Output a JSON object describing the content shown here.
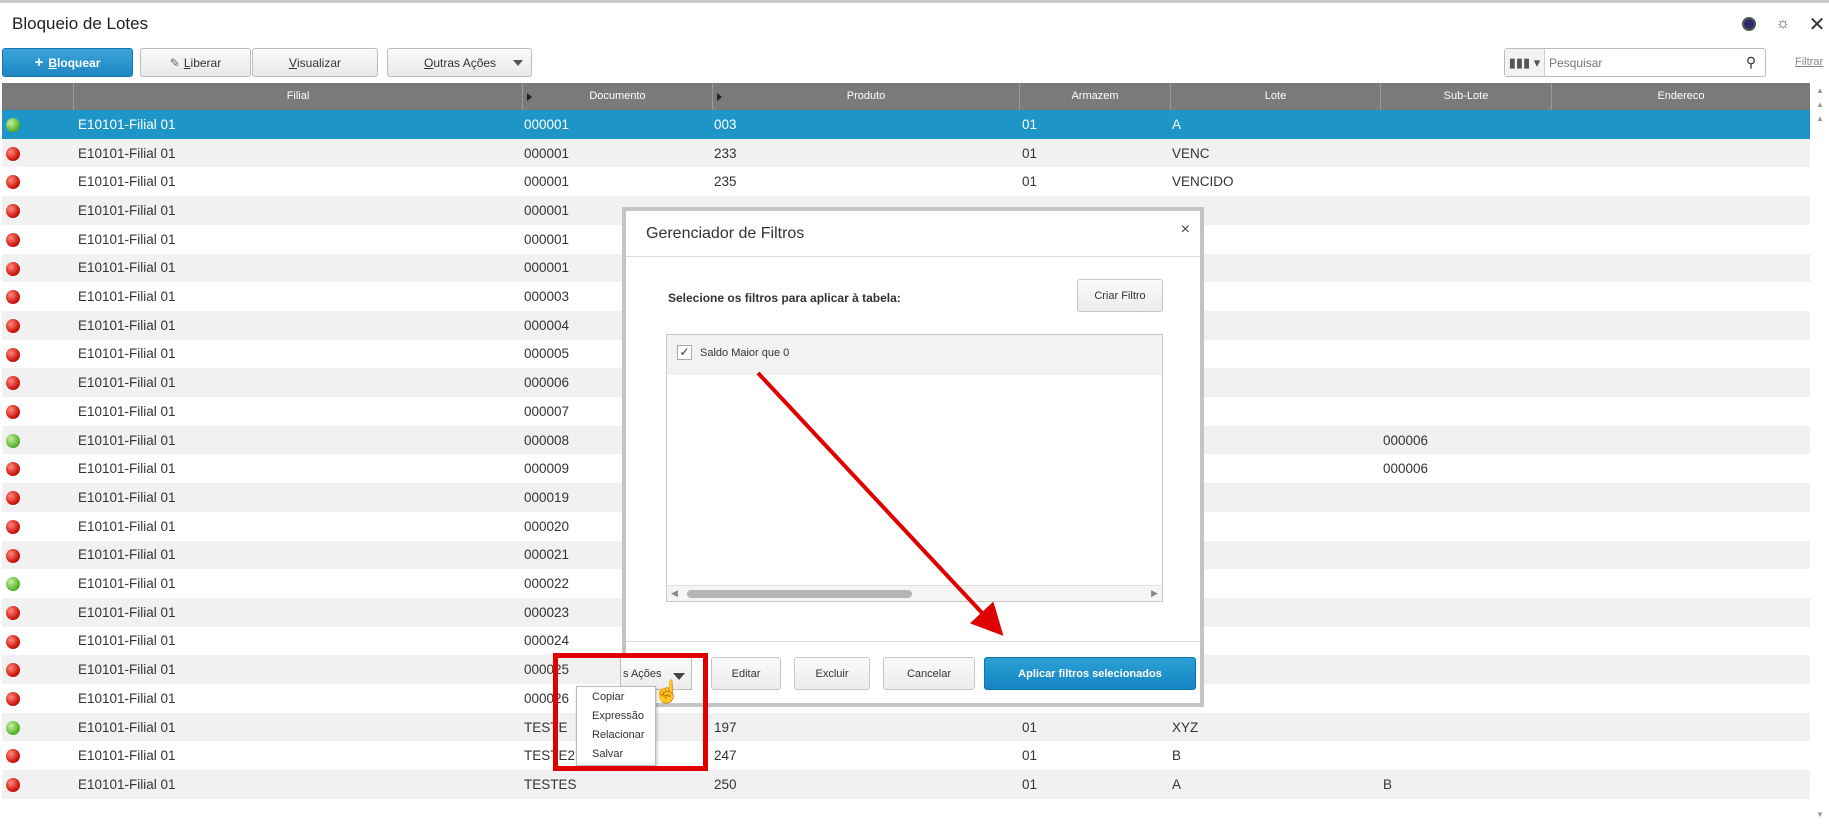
{
  "page": {
    "title": "Bloqueio de Lotes"
  },
  "toolbar": {
    "bloquear_plus": "+",
    "bloquear_first": "B",
    "bloquear_rest": "loquear",
    "liberar_first": "L",
    "liberar_rest": "iberar",
    "visualizar_first": "V",
    "visualizar_rest": "isualizar",
    "outras_first": "O",
    "outras_rest": "utras Ações",
    "search_placeholder": "Pesquisar",
    "filtrar": "Filtrar"
  },
  "grid": {
    "columns": [
      "Filial",
      "Documento",
      "Produto",
      "Armazem",
      "Lote",
      "Sub-Lote",
      "Endereco"
    ],
    "rows": [
      {
        "status": "green",
        "filial": "E10101-Filial 01",
        "documento": "000001",
        "produto": "003",
        "armazem": "01",
        "lote": "A",
        "sublote": "",
        "endereco": ""
      },
      {
        "status": "red",
        "filial": "E10101-Filial 01",
        "documento": "000001",
        "produto": "233",
        "armazem": "01",
        "lote": "VENC",
        "sublote": "",
        "endereco": ""
      },
      {
        "status": "red",
        "filial": "E10101-Filial 01",
        "documento": "000001",
        "produto": "235",
        "armazem": "01",
        "lote": "VENCIDO",
        "sublote": "",
        "endereco": ""
      },
      {
        "status": "red",
        "filial": "E10101-Filial 01",
        "documento": "000001",
        "produto": "",
        "armazem": "",
        "lote": "",
        "sublote": "",
        "endereco": ""
      },
      {
        "status": "red",
        "filial": "E10101-Filial 01",
        "documento": "000001",
        "produto": "",
        "armazem": "",
        "lote": "",
        "sublote": "",
        "endereco": ""
      },
      {
        "status": "red",
        "filial": "E10101-Filial 01",
        "documento": "000001",
        "produto": "",
        "armazem": "",
        "lote": "",
        "sublote": "",
        "endereco": ""
      },
      {
        "status": "red",
        "filial": "E10101-Filial 01",
        "documento": "000003",
        "produto": "",
        "armazem": "",
        "lote": "",
        "sublote": "",
        "endereco": ""
      },
      {
        "status": "red",
        "filial": "E10101-Filial 01",
        "documento": "000004",
        "produto": "",
        "armazem": "",
        "lote": "",
        "sublote": "",
        "endereco": ""
      },
      {
        "status": "red",
        "filial": "E10101-Filial 01",
        "documento": "000005",
        "produto": "",
        "armazem": "",
        "lote": "",
        "sublote": "",
        "endereco": ""
      },
      {
        "status": "red",
        "filial": "E10101-Filial 01",
        "documento": "000006",
        "produto": "",
        "armazem": "",
        "lote": "",
        "sublote": "",
        "endereco": ""
      },
      {
        "status": "red",
        "filial": "E10101-Filial 01",
        "documento": "000007",
        "produto": "",
        "armazem": "",
        "lote": "",
        "sublote": "",
        "endereco": ""
      },
      {
        "status": "green",
        "filial": "E10101-Filial 01",
        "documento": "000008",
        "produto": "",
        "armazem": "",
        "lote": "",
        "sublote": "000006",
        "endereco": ""
      },
      {
        "status": "red",
        "filial": "E10101-Filial 01",
        "documento": "000009",
        "produto": "",
        "armazem": "",
        "lote": "",
        "sublote": "000006",
        "endereco": ""
      },
      {
        "status": "red",
        "filial": "E10101-Filial 01",
        "documento": "000019",
        "produto": "",
        "armazem": "",
        "lote": "",
        "sublote": "",
        "endereco": ""
      },
      {
        "status": "red",
        "filial": "E10101-Filial 01",
        "documento": "000020",
        "produto": "",
        "armazem": "",
        "lote": "",
        "sublote": "",
        "endereco": ""
      },
      {
        "status": "red",
        "filial": "E10101-Filial 01",
        "documento": "000021",
        "produto": "",
        "armazem": "",
        "lote": "",
        "sublote": "",
        "endereco": ""
      },
      {
        "status": "green",
        "filial": "E10101-Filial 01",
        "documento": "000022",
        "produto": "",
        "armazem": "",
        "lote": "",
        "sublote": "",
        "endereco": ""
      },
      {
        "status": "red",
        "filial": "E10101-Filial 01",
        "documento": "000023",
        "produto": "",
        "armazem": "",
        "lote": "",
        "sublote": "",
        "endereco": ""
      },
      {
        "status": "red",
        "filial": "E10101-Filial 01",
        "documento": "000024",
        "produto": "",
        "armazem": "",
        "lote": "",
        "sublote": "",
        "endereco": ""
      },
      {
        "status": "red",
        "filial": "E10101-Filial 01",
        "documento": "000025",
        "produto": "",
        "armazem": "",
        "lote": "",
        "sublote": "",
        "endereco": ""
      },
      {
        "status": "red",
        "filial": "E10101-Filial 01",
        "documento": "000026",
        "produto": "",
        "armazem": "",
        "lote": "",
        "sublote": "",
        "endereco": ""
      },
      {
        "status": "green",
        "filial": "E10101-Filial 01",
        "documento": "TESTE",
        "produto": "197",
        "armazem": "01",
        "lote": "XYZ",
        "sublote": "",
        "endereco": ""
      },
      {
        "status": "red",
        "filial": "E10101-Filial 01",
        "documento": "TESTE2",
        "produto": "247",
        "armazem": "01",
        "lote": "B",
        "sublote": "",
        "endereco": ""
      },
      {
        "status": "red",
        "filial": "E10101-Filial 01",
        "documento": "TESTES",
        "produto": "250",
        "armazem": "01",
        "lote": "A",
        "sublote": "B",
        "endereco": ""
      }
    ]
  },
  "dialog": {
    "title": "Gerenciador de Filtros",
    "close": "×",
    "instruction": "Selecione os filtros para aplicar à tabela:",
    "criar_filtro": "Criar Filtro",
    "filters": [
      {
        "label": "Saldo Maior que 0",
        "checked": true,
        "check_glyph": "✓"
      }
    ],
    "outras_label": "s Ações",
    "editar": "Editar",
    "excluir": "Excluir",
    "cancelar": "Cancelar",
    "aplicar": "Aplicar filtros selecionados"
  },
  "menu": {
    "items": [
      "Copiar",
      "Expressão",
      "Relacionar",
      "Salvar"
    ]
  },
  "colors": {
    "accent": "#1e95c7",
    "annotation": "#e00000",
    "header": "#7a7a7a"
  },
  "icons": {
    "status_green": "green-status-icon",
    "status_red": "red-status-icon",
    "search": "search-icon",
    "columns": "columns-icon",
    "close": "close-icon",
    "settings": "gear-icon"
  }
}
